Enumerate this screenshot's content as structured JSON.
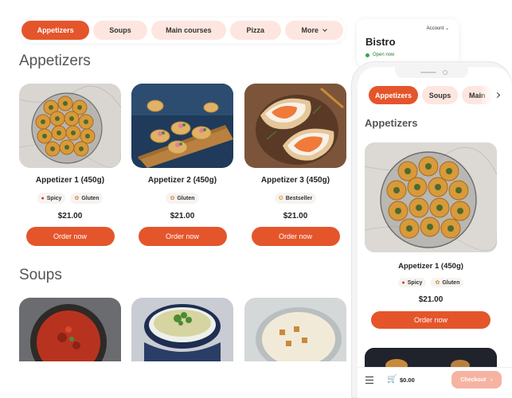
{
  "desktop": {
    "nav": [
      {
        "label": "Appetizers",
        "active": true
      },
      {
        "label": "Soups"
      },
      {
        "label": "Main courses"
      },
      {
        "label": "Pizza"
      },
      {
        "label": "More"
      }
    ],
    "sections": [
      {
        "title": "Appetizers"
      },
      {
        "title": "Soups"
      }
    ],
    "appetizers": [
      {
        "title": "Appetizer 1 (450g)",
        "tags": [
          {
            "icon": "chili-icon",
            "label": "Spicy"
          },
          {
            "icon": "wheat-icon",
            "label": "Gluten"
          }
        ],
        "price": "$21.00",
        "button": "Order now"
      },
      {
        "title": "Appetizer 2 (450g)",
        "tags": [
          {
            "icon": "wheat-icon",
            "label": "Gluten"
          }
        ],
        "price": "$21.00",
        "button": "Order now"
      },
      {
        "title": "Appetizer 3 (450g)",
        "tags": [
          {
            "icon": "award-icon",
            "label": "Bestseller"
          }
        ],
        "price": "$21.00",
        "button": "Order now"
      }
    ]
  },
  "mobile": {
    "restaurant": {
      "name": "Bistro",
      "account": "Account",
      "status": "Open now"
    },
    "nav": [
      {
        "label": "Appetizers",
        "active": true
      },
      {
        "label": "Soups"
      },
      {
        "label": "Main"
      }
    ],
    "section_title": "Appetizers",
    "item": {
      "title": "Appetizer 1 (450g)",
      "tags": [
        {
          "icon": "chili-icon",
          "label": "Spicy"
        },
        {
          "icon": "wheat-icon",
          "label": "Gluten"
        }
      ],
      "price": "$21.00",
      "button": "Order now"
    },
    "bottom_bar": {
      "total": "$0.00",
      "checkout": "Checkout"
    }
  },
  "colors": {
    "accent": "#e5552b",
    "pill": "#fde6df",
    "open": "#2fa84f",
    "checkout": "#f6b3a1"
  }
}
